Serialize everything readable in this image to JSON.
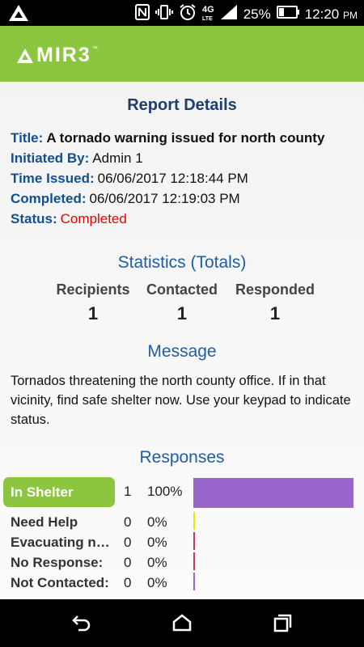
{
  "status_bar": {
    "battery": "25%",
    "time": "12:20",
    "ampm": "PM",
    "network": "4G LTE"
  },
  "app": {
    "logo_text": "MIR3",
    "logo_tm": "™"
  },
  "report": {
    "heading": "Report Details",
    "title_label": "Title:",
    "title_value": "A tornado warning issued for north county",
    "initiated_label": "Initiated By:",
    "initiated_value": "Admin 1",
    "time_issued_label": "Time Issued:",
    "time_issued_value": "06/06/2017 12:18:44 PM",
    "completed_label": "Completed:",
    "completed_value": "06/06/2017 12:19:03 PM",
    "status_label": "Status:",
    "status_value": "Completed"
  },
  "statistics": {
    "heading": "Statistics (Totals)",
    "columns": [
      {
        "label": "Recipients",
        "value": "1"
      },
      {
        "label": "Contacted",
        "value": "1"
      },
      {
        "label": "Responded",
        "value": "1"
      }
    ]
  },
  "message": {
    "heading": "Message",
    "body": "Tornados threatening the north county office. If in that vicinity, find safe shelter now. Use your keypad to indicate status."
  },
  "responses": {
    "heading": "Responses",
    "items": [
      {
        "label": "In Shelter",
        "count": "1",
        "percent": "100%",
        "fraction": 1.0,
        "color": "#9966cc"
      },
      {
        "label": "Need Help",
        "count": "0",
        "percent": "0%",
        "fraction": 0,
        "color": "#e8e800"
      },
      {
        "label": "Evacuating n…",
        "count": "0",
        "percent": "0%",
        "fraction": 0,
        "color": "#cc3366"
      },
      {
        "label": "No Response:",
        "count": "0",
        "percent": "0%",
        "fraction": 0,
        "color": "#cc3366"
      },
      {
        "label": "Not Contacted:",
        "count": "0",
        "percent": "0%",
        "fraction": 0,
        "color": "#9966cc"
      }
    ]
  },
  "colors": {
    "brand_green": "#8cc63f",
    "label_blue": "#12508f",
    "status_red": "#ee0000"
  }
}
